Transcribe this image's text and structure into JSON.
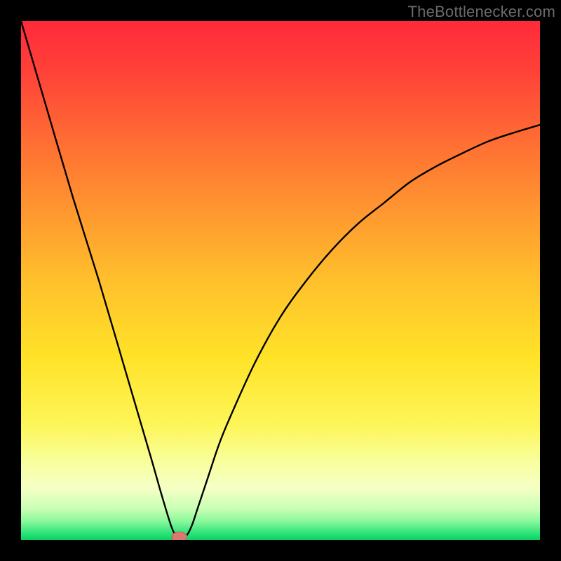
{
  "watermark": {
    "text": "TheBottlenecker.com"
  },
  "colors": {
    "frame_bg": "#000000",
    "curve": "#000000",
    "marker_fill": "#d9796f",
    "marker_outline": "#c85b52",
    "gradient_stops": [
      {
        "offset": 0.0,
        "color": "#ff2a3a"
      },
      {
        "offset": 0.1,
        "color": "#ff4238"
      },
      {
        "offset": 0.22,
        "color": "#ff6a34"
      },
      {
        "offset": 0.35,
        "color": "#ff9230"
      },
      {
        "offset": 0.5,
        "color": "#ffc02c"
      },
      {
        "offset": 0.65,
        "color": "#ffe328"
      },
      {
        "offset": 0.78,
        "color": "#fdf65a"
      },
      {
        "offset": 0.85,
        "color": "#f8ff9e"
      },
      {
        "offset": 0.9,
        "color": "#f5ffc4"
      },
      {
        "offset": 0.94,
        "color": "#c9ffb4"
      },
      {
        "offset": 0.965,
        "color": "#86f89a"
      },
      {
        "offset": 0.985,
        "color": "#34e57e"
      },
      {
        "offset": 1.0,
        "color": "#09d362"
      }
    ]
  },
  "chart_data": {
    "type": "line",
    "title": "",
    "xlabel": "",
    "ylabel": "",
    "ylim": [
      0,
      100
    ],
    "xlim": [
      0,
      100
    ],
    "series": [
      {
        "name": "bottleneck-curve",
        "x": [
          0,
          5,
          10,
          15,
          20,
          25,
          27,
          29,
          30,
          31,
          32,
          33,
          34,
          36,
          38,
          40,
          45,
          50,
          55,
          60,
          65,
          70,
          75,
          80,
          85,
          90,
          95,
          100
        ],
        "values": [
          100,
          83,
          66,
          50,
          33,
          16,
          9,
          2.5,
          0.8,
          0.5,
          1.0,
          3,
          6,
          12,
          18,
          23,
          34,
          43,
          50,
          56,
          61,
          65,
          69,
          72,
          74.5,
          76.8,
          78.5,
          80
        ]
      }
    ],
    "annotations": [
      {
        "name": "optimal-marker",
        "x": 30.5,
        "y": 0.6
      }
    ]
  }
}
